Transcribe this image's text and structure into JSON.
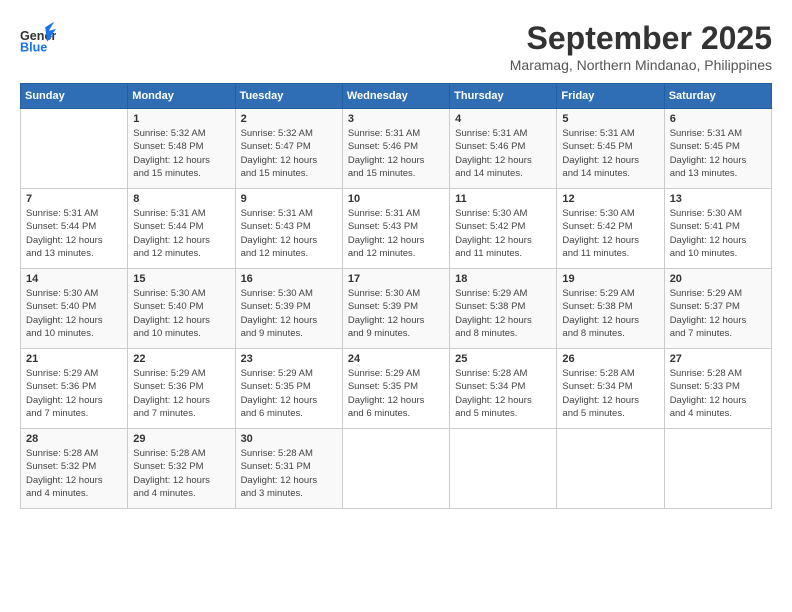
{
  "header": {
    "logo_line1": "General",
    "logo_line2": "Blue",
    "month": "September 2025",
    "location": "Maramag, Northern Mindanao, Philippines"
  },
  "weekdays": [
    "Sunday",
    "Monday",
    "Tuesday",
    "Wednesday",
    "Thursday",
    "Friday",
    "Saturday"
  ],
  "weeks": [
    [
      {
        "day": "",
        "text": ""
      },
      {
        "day": "1",
        "text": "Sunrise: 5:32 AM\nSunset: 5:48 PM\nDaylight: 12 hours\nand 15 minutes."
      },
      {
        "day": "2",
        "text": "Sunrise: 5:32 AM\nSunset: 5:47 PM\nDaylight: 12 hours\nand 15 minutes."
      },
      {
        "day": "3",
        "text": "Sunrise: 5:31 AM\nSunset: 5:46 PM\nDaylight: 12 hours\nand 15 minutes."
      },
      {
        "day": "4",
        "text": "Sunrise: 5:31 AM\nSunset: 5:46 PM\nDaylight: 12 hours\nand 14 minutes."
      },
      {
        "day": "5",
        "text": "Sunrise: 5:31 AM\nSunset: 5:45 PM\nDaylight: 12 hours\nand 14 minutes."
      },
      {
        "day": "6",
        "text": "Sunrise: 5:31 AM\nSunset: 5:45 PM\nDaylight: 12 hours\nand 13 minutes."
      }
    ],
    [
      {
        "day": "7",
        "text": "Sunrise: 5:31 AM\nSunset: 5:44 PM\nDaylight: 12 hours\nand 13 minutes."
      },
      {
        "day": "8",
        "text": "Sunrise: 5:31 AM\nSunset: 5:44 PM\nDaylight: 12 hours\nand 12 minutes."
      },
      {
        "day": "9",
        "text": "Sunrise: 5:31 AM\nSunset: 5:43 PM\nDaylight: 12 hours\nand 12 minutes."
      },
      {
        "day": "10",
        "text": "Sunrise: 5:31 AM\nSunset: 5:43 PM\nDaylight: 12 hours\nand 12 minutes."
      },
      {
        "day": "11",
        "text": "Sunrise: 5:30 AM\nSunset: 5:42 PM\nDaylight: 12 hours\nand 11 minutes."
      },
      {
        "day": "12",
        "text": "Sunrise: 5:30 AM\nSunset: 5:42 PM\nDaylight: 12 hours\nand 11 minutes."
      },
      {
        "day": "13",
        "text": "Sunrise: 5:30 AM\nSunset: 5:41 PM\nDaylight: 12 hours\nand 10 minutes."
      }
    ],
    [
      {
        "day": "14",
        "text": "Sunrise: 5:30 AM\nSunset: 5:40 PM\nDaylight: 12 hours\nand 10 minutes."
      },
      {
        "day": "15",
        "text": "Sunrise: 5:30 AM\nSunset: 5:40 PM\nDaylight: 12 hours\nand 10 minutes."
      },
      {
        "day": "16",
        "text": "Sunrise: 5:30 AM\nSunset: 5:39 PM\nDaylight: 12 hours\nand 9 minutes."
      },
      {
        "day": "17",
        "text": "Sunrise: 5:30 AM\nSunset: 5:39 PM\nDaylight: 12 hours\nand 9 minutes."
      },
      {
        "day": "18",
        "text": "Sunrise: 5:29 AM\nSunset: 5:38 PM\nDaylight: 12 hours\nand 8 minutes."
      },
      {
        "day": "19",
        "text": "Sunrise: 5:29 AM\nSunset: 5:38 PM\nDaylight: 12 hours\nand 8 minutes."
      },
      {
        "day": "20",
        "text": "Sunrise: 5:29 AM\nSunset: 5:37 PM\nDaylight: 12 hours\nand 7 minutes."
      }
    ],
    [
      {
        "day": "21",
        "text": "Sunrise: 5:29 AM\nSunset: 5:36 PM\nDaylight: 12 hours\nand 7 minutes."
      },
      {
        "day": "22",
        "text": "Sunrise: 5:29 AM\nSunset: 5:36 PM\nDaylight: 12 hours\nand 7 minutes."
      },
      {
        "day": "23",
        "text": "Sunrise: 5:29 AM\nSunset: 5:35 PM\nDaylight: 12 hours\nand 6 minutes."
      },
      {
        "day": "24",
        "text": "Sunrise: 5:29 AM\nSunset: 5:35 PM\nDaylight: 12 hours\nand 6 minutes."
      },
      {
        "day": "25",
        "text": "Sunrise: 5:28 AM\nSunset: 5:34 PM\nDaylight: 12 hours\nand 5 minutes."
      },
      {
        "day": "26",
        "text": "Sunrise: 5:28 AM\nSunset: 5:34 PM\nDaylight: 12 hours\nand 5 minutes."
      },
      {
        "day": "27",
        "text": "Sunrise: 5:28 AM\nSunset: 5:33 PM\nDaylight: 12 hours\nand 4 minutes."
      }
    ],
    [
      {
        "day": "28",
        "text": "Sunrise: 5:28 AM\nSunset: 5:32 PM\nDaylight: 12 hours\nand 4 minutes."
      },
      {
        "day": "29",
        "text": "Sunrise: 5:28 AM\nSunset: 5:32 PM\nDaylight: 12 hours\nand 4 minutes."
      },
      {
        "day": "30",
        "text": "Sunrise: 5:28 AM\nSunset: 5:31 PM\nDaylight: 12 hours\nand 3 minutes."
      },
      {
        "day": "",
        "text": ""
      },
      {
        "day": "",
        "text": ""
      },
      {
        "day": "",
        "text": ""
      },
      {
        "day": "",
        "text": ""
      }
    ]
  ]
}
